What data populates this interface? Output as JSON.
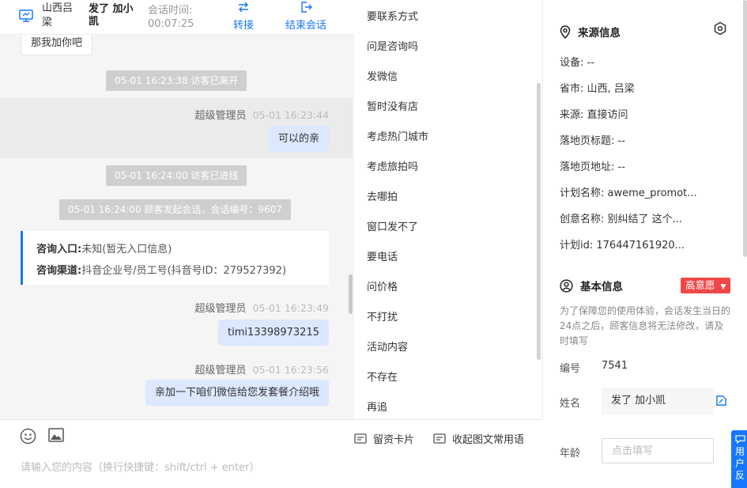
{
  "chat_header": {
    "location": "山西吕梁",
    "visitor_name": "发了 加小凯",
    "duration_label": "会话时间:",
    "duration": "00:07:25",
    "transfer_label": "转接",
    "end_label": "结束会话"
  },
  "messages": {
    "prev_bubble": "那我加你吧",
    "sys_left": "05-01 16:23:38 访客已离开",
    "m1_author": "超级管理员",
    "m1_time": "05-01 16:23:44",
    "m1_text": "可以的亲",
    "sys_enter": "05-01 16:24:00 访客已进线",
    "sys_session": "05-01 16:24:00 顾客发起会话，会话编号：9607",
    "card_entry_label": "咨询入口:",
    "card_entry_value": "未知(暂无入口信息)",
    "card_channel_label": "咨询渠道:",
    "card_channel_value": "抖音企业号/员工号(抖音号ID：279527392)",
    "m2_author": "超级管理员",
    "m2_time": "05-01 16:23:49",
    "m2_text": "timi13398973215",
    "m3_author": "超级管理员",
    "m3_time": "05-01 16:23:56",
    "m3_text": "亲加一下咱们微信给您发套餐介绍哦"
  },
  "composer": {
    "placeholder": "请输入您的内容（换行快捷键：shift/ctrl + enter）"
  },
  "quick_phrases": [
    "要联系方式",
    "问是咨询吗",
    "发微信",
    "暂时没有店",
    "考虑热门城市",
    "考虑旅拍吗",
    "去哪拍",
    "窗口发不了",
    "要电话",
    "问价格",
    "不打扰",
    "活动内容",
    "不存在",
    "再追"
  ],
  "quick_footer": {
    "lead_card": "留资卡片",
    "collapse": "收起图文常用语"
  },
  "source": {
    "title": "来源信息",
    "device": "设备: --",
    "province": "省市: 山西, 吕梁",
    "origin": "来源: 直接访问",
    "landing_title": "落地页标题: --",
    "landing_url": "落地页地址: --",
    "plan_name": "计划名称: aweme_promot...",
    "creative_name": "创意名称: 别纠结了 这个...",
    "plan_id": "计划id: 176447161920..."
  },
  "basic": {
    "title": "基本信息",
    "intent": "高意愿",
    "note": "为了保障您的使用体验，会话发生当日的24点之后，顾客信息将无法修改，请及时填写",
    "id_label": "编号",
    "id_value": "7541",
    "name_label": "姓名",
    "name_value": "发了 加小凯",
    "age_label": "年龄",
    "age_placeholder": "点击填写"
  },
  "feedback_label": "用户反",
  "colors": {
    "accent": "#1677ff",
    "outgoing_bubble": "#dbe8ff",
    "intent_badge": "#f04848",
    "system_pill": "#cfcfcf"
  },
  "icons": {
    "header": "monitor-icon",
    "transfer": "transfer-arrows-icon",
    "end": "exit-icon",
    "emoji": "emoji-icon",
    "image": "image-icon",
    "source": "location-pin-icon",
    "settings": "hexagon-settings-icon",
    "basic": "user-circle-icon",
    "edit": "edit-icon",
    "feedback": "chat-bubble-icon"
  }
}
